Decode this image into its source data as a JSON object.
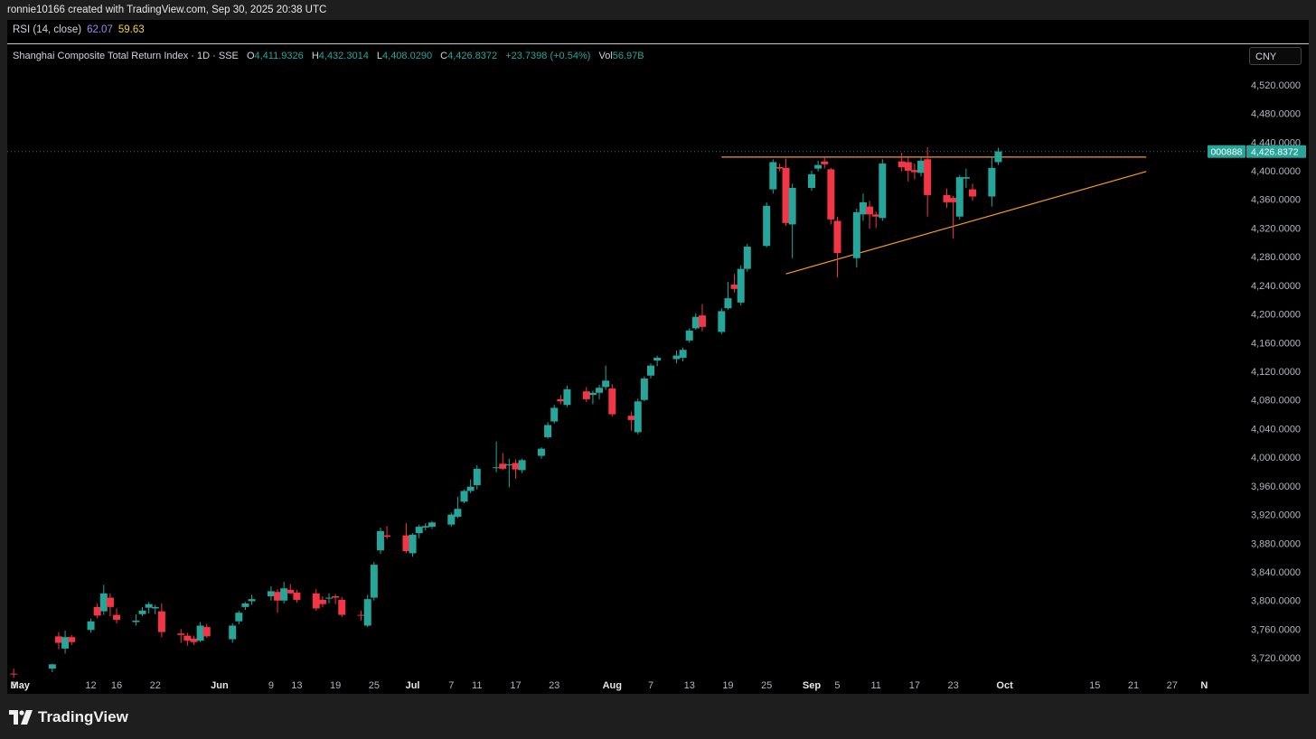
{
  "header": {
    "author_line": "ronnie10166 created with TradingView.com, Sep 30, 2025 20:38 UTC"
  },
  "rsi": {
    "label": "RSI (14, close)",
    "value1": "62.07",
    "value2": "59.63"
  },
  "legend": {
    "symbol": "Shanghai Composite Total Return Index · 1D · SSE",
    "o_label": "O",
    "o_value": "4,411.9326",
    "h_label": "H",
    "h_value": "4,432.3014",
    "l_label": "L",
    "l_value": "4,408.0290",
    "c_label": "C",
    "c_value": "4,426.8372",
    "change": "+23.7398 (+0.54%)",
    "vol_label": "Vol",
    "vol_value": "56.97B"
  },
  "currency": "CNY",
  "price_label": {
    "ticker": "000888",
    "price": "4,426.8372",
    "value": 4426.8372
  },
  "colors": {
    "up": "#26a69a",
    "down": "#f23645",
    "trendline": "#f59a23",
    "background": "#000000"
  },
  "brand": "TradingView",
  "chart_data": {
    "type": "candlestick",
    "y_axis": {
      "ticks": [
        3720,
        3760,
        3800,
        3840,
        3880,
        3920,
        3960,
        4000,
        4040,
        4080,
        4120,
        4160,
        4200,
        4240,
        4280,
        4320,
        4360,
        4400,
        4440,
        4480,
        4520
      ],
      "tick_labels": [
        "3,720.0000",
        "3,760.0000",
        "3,800.0000",
        "3,840.0000",
        "3,880.0000",
        "3,920.0000",
        "3,960.0000",
        "4,000.0000",
        "4,040.0000",
        "4,080.0000",
        "4,120.0000",
        "4,160.0000",
        "4,200.0000",
        "4,240.0000",
        "4,280.0000",
        "4,320.0000",
        "4,360.0000",
        "4,400.0000",
        "4,440.0000",
        "4,480.0000",
        "4,520.0000"
      ],
      "range": [
        3695,
        4545
      ]
    },
    "x_axis": {
      "ticks": [
        {
          "date": "2025-04-30",
          "label": "3",
          "bold": false
        },
        {
          "date": "2025-05-01",
          "label": "May",
          "bold": true
        },
        {
          "date": "2025-05-12",
          "label": "12",
          "bold": false
        },
        {
          "date": "2025-05-16",
          "label": "16",
          "bold": false
        },
        {
          "date": "2025-05-22",
          "label": "22",
          "bold": false
        },
        {
          "date": "2025-06-01",
          "label": "Jun",
          "bold": true
        },
        {
          "date": "2025-06-09",
          "label": "9",
          "bold": false
        },
        {
          "date": "2025-06-13",
          "label": "13",
          "bold": false
        },
        {
          "date": "2025-06-19",
          "label": "19",
          "bold": false
        },
        {
          "date": "2025-06-25",
          "label": "25",
          "bold": false
        },
        {
          "date": "2025-07-01",
          "label": "Jul",
          "bold": true
        },
        {
          "date": "2025-07-07",
          "label": "7",
          "bold": false
        },
        {
          "date": "2025-07-11",
          "label": "11",
          "bold": false
        },
        {
          "date": "2025-07-17",
          "label": "17",
          "bold": false
        },
        {
          "date": "2025-07-23",
          "label": "23",
          "bold": false
        },
        {
          "date": "2025-08-01",
          "label": "Aug",
          "bold": true
        },
        {
          "date": "2025-08-07",
          "label": "7",
          "bold": false
        },
        {
          "date": "2025-08-13",
          "label": "13",
          "bold": false
        },
        {
          "date": "2025-08-19",
          "label": "19",
          "bold": false
        },
        {
          "date": "2025-08-25",
          "label": "25",
          "bold": false
        },
        {
          "date": "2025-09-01",
          "label": "Sep",
          "bold": true
        },
        {
          "date": "2025-09-05",
          "label": "5",
          "bold": false
        },
        {
          "date": "2025-09-11",
          "label": "11",
          "bold": false
        },
        {
          "date": "2025-09-17",
          "label": "17",
          "bold": false
        },
        {
          "date": "2025-09-23",
          "label": "23",
          "bold": false
        },
        {
          "date": "2025-10-01",
          "label": "Oct",
          "bold": true
        },
        {
          "date": "2025-10-15",
          "label": "15",
          "bold": false
        },
        {
          "date": "2025-10-21",
          "label": "21",
          "bold": false
        },
        {
          "date": "2025-10-27",
          "label": "27",
          "bold": false
        },
        {
          "date": "2025-11-01",
          "label": "N",
          "bold": true
        }
      ]
    },
    "candles": [
      {
        "d": "2025-04-30",
        "o": 3698,
        "h": 3705,
        "l": 3692,
        "c": 3697
      },
      {
        "d": "2025-05-06",
        "o": 3705,
        "h": 3712,
        "l": 3700,
        "c": 3711
      },
      {
        "d": "2025-05-07",
        "o": 3750,
        "h": 3756,
        "l": 3732,
        "c": 3741
      },
      {
        "d": "2025-05-08",
        "o": 3733,
        "h": 3758,
        "l": 3726,
        "c": 3749
      },
      {
        "d": "2025-05-09",
        "o": 3749,
        "h": 3752,
        "l": 3738,
        "c": 3742
      },
      {
        "d": "2025-05-12",
        "o": 3759,
        "h": 3775,
        "l": 3755,
        "c": 3771
      },
      {
        "d": "2025-05-13",
        "o": 3791,
        "h": 3796,
        "l": 3775,
        "c": 3779
      },
      {
        "d": "2025-05-14",
        "o": 3785,
        "h": 3822,
        "l": 3780,
        "c": 3810
      },
      {
        "d": "2025-05-15",
        "o": 3804,
        "h": 3810,
        "l": 3778,
        "c": 3791
      },
      {
        "d": "2025-05-16",
        "o": 3780,
        "h": 3789,
        "l": 3768,
        "c": 3773
      },
      {
        "d": "2025-05-19",
        "o": 3770,
        "h": 3781,
        "l": 3765,
        "c": 3772
      },
      {
        "d": "2025-05-20",
        "o": 3781,
        "h": 3791,
        "l": 3778,
        "c": 3786
      },
      {
        "d": "2025-05-21",
        "o": 3790,
        "h": 3798,
        "l": 3782,
        "c": 3795
      },
      {
        "d": "2025-05-22",
        "o": 3789,
        "h": 3794,
        "l": 3781,
        "c": 3791
      },
      {
        "d": "2025-05-23",
        "o": 3785,
        "h": 3796,
        "l": 3749,
        "c": 3756
      },
      {
        "d": "2025-05-26",
        "o": 3754,
        "h": 3760,
        "l": 3741,
        "c": 3752
      },
      {
        "d": "2025-05-27",
        "o": 3751,
        "h": 3755,
        "l": 3737,
        "c": 3744
      },
      {
        "d": "2025-05-28",
        "o": 3747,
        "h": 3751,
        "l": 3738,
        "c": 3742
      },
      {
        "d": "2025-05-29",
        "o": 3744,
        "h": 3770,
        "l": 3742,
        "c": 3765
      },
      {
        "d": "2025-05-30",
        "o": 3763,
        "h": 3767,
        "l": 3748,
        "c": 3750
      },
      {
        "d": "2025-06-03",
        "o": 3746,
        "h": 3768,
        "l": 3741,
        "c": 3765
      },
      {
        "d": "2025-06-04",
        "o": 3771,
        "h": 3786,
        "l": 3767,
        "c": 3783
      },
      {
        "d": "2025-06-05",
        "o": 3791,
        "h": 3798,
        "l": 3787,
        "c": 3796
      },
      {
        "d": "2025-06-06",
        "o": 3799,
        "h": 3808,
        "l": 3794,
        "c": 3802
      },
      {
        "d": "2025-06-09",
        "o": 3806,
        "h": 3820,
        "l": 3800,
        "c": 3813
      },
      {
        "d": "2025-06-10",
        "o": 3812,
        "h": 3816,
        "l": 3783,
        "c": 3800
      },
      {
        "d": "2025-06-11",
        "o": 3800,
        "h": 3826,
        "l": 3796,
        "c": 3817
      },
      {
        "d": "2025-06-12",
        "o": 3815,
        "h": 3823,
        "l": 3809,
        "c": 3810
      },
      {
        "d": "2025-06-13",
        "o": 3811,
        "h": 3815,
        "l": 3797,
        "c": 3801
      },
      {
        "d": "2025-06-16",
        "o": 3810,
        "h": 3816,
        "l": 3786,
        "c": 3789
      },
      {
        "d": "2025-06-17",
        "o": 3801,
        "h": 3806,
        "l": 3791,
        "c": 3795
      },
      {
        "d": "2025-06-18",
        "o": 3803,
        "h": 3810,
        "l": 3796,
        "c": 3804
      },
      {
        "d": "2025-06-19",
        "o": 3806,
        "h": 3809,
        "l": 3795,
        "c": 3804
      },
      {
        "d": "2025-06-20",
        "o": 3801,
        "h": 3805,
        "l": 3777,
        "c": 3780
      },
      {
        "d": "2025-06-23",
        "o": 3780,
        "h": 3786,
        "l": 3772,
        "c": 3779
      },
      {
        "d": "2025-06-24",
        "o": 3765,
        "h": 3808,
        "l": 3763,
        "c": 3802
      },
      {
        "d": "2025-06-25",
        "o": 3804,
        "h": 3854,
        "l": 3800,
        "c": 3850
      },
      {
        "d": "2025-06-26",
        "o": 3870,
        "h": 3902,
        "l": 3865,
        "c": 3897
      },
      {
        "d": "2025-06-27",
        "o": 3891,
        "h": 3904,
        "l": 3886,
        "c": 3889
      },
      {
        "d": "2025-06-30",
        "o": 3891,
        "h": 3908,
        "l": 3866,
        "c": 3869
      },
      {
        "d": "2025-07-01",
        "o": 3866,
        "h": 3894,
        "l": 3861,
        "c": 3892
      },
      {
        "d": "2025-07-02",
        "o": 3894,
        "h": 3906,
        "l": 3887,
        "c": 3903
      },
      {
        "d": "2025-07-03",
        "o": 3902,
        "h": 3908,
        "l": 3898,
        "c": 3904
      },
      {
        "d": "2025-07-04",
        "o": 3903,
        "h": 3911,
        "l": 3900,
        "c": 3909
      },
      {
        "d": "2025-07-07",
        "o": 3906,
        "h": 3923,
        "l": 3903,
        "c": 3920
      },
      {
        "d": "2025-07-08",
        "o": 3917,
        "h": 3945,
        "l": 3915,
        "c": 3928
      },
      {
        "d": "2025-07-09",
        "o": 3938,
        "h": 3955,
        "l": 3936,
        "c": 3953
      },
      {
        "d": "2025-07-10",
        "o": 3953,
        "h": 3969,
        "l": 3950,
        "c": 3959
      },
      {
        "d": "2025-07-11",
        "o": 3961,
        "h": 3989,
        "l": 3955,
        "c": 3984
      },
      {
        "d": "2025-07-14",
        "o": 3985,
        "h": 4022,
        "l": 3979,
        "c": 3986
      },
      {
        "d": "2025-07-15",
        "o": 3991,
        "h": 4006,
        "l": 3982,
        "c": 3984
      },
      {
        "d": "2025-07-16",
        "o": 3990,
        "h": 3998,
        "l": 3958,
        "c": 3990
      },
      {
        "d": "2025-07-17",
        "o": 3992,
        "h": 3997,
        "l": 3970,
        "c": 3983
      },
      {
        "d": "2025-07-18",
        "o": 3982,
        "h": 3998,
        "l": 3978,
        "c": 3996
      },
      {
        "d": "2025-07-21",
        "o": 4002,
        "h": 4014,
        "l": 3998,
        "c": 4012
      },
      {
        "d": "2025-07-22",
        "o": 4028,
        "h": 4049,
        "l": 4026,
        "c": 4045
      },
      {
        "d": "2025-07-23",
        "o": 4050,
        "h": 4073,
        "l": 4047,
        "c": 4069
      },
      {
        "d": "2025-07-24",
        "o": 4081,
        "h": 4087,
        "l": 4074,
        "c": 4078
      },
      {
        "d": "2025-07-25",
        "o": 4073,
        "h": 4100,
        "l": 4070,
        "c": 4095
      },
      {
        "d": "2025-07-28",
        "o": 4092,
        "h": 4098,
        "l": 4077,
        "c": 4081
      },
      {
        "d": "2025-07-29",
        "o": 4087,
        "h": 4093,
        "l": 4074,
        "c": 4090
      },
      {
        "d": "2025-07-30",
        "o": 4090,
        "h": 4101,
        "l": 4081,
        "c": 4097
      },
      {
        "d": "2025-07-31",
        "o": 4098,
        "h": 4128,
        "l": 4094,
        "c": 4107
      },
      {
        "d": "2025-08-01",
        "o": 4096,
        "h": 4102,
        "l": 4057,
        "c": 4060
      },
      {
        "d": "2025-08-04",
        "o": 4058,
        "h": 4064,
        "l": 4037,
        "c": 4052
      },
      {
        "d": "2025-08-05",
        "o": 4035,
        "h": 4082,
        "l": 4032,
        "c": 4078
      },
      {
        "d": "2025-08-06",
        "o": 4080,
        "h": 4113,
        "l": 4078,
        "c": 4110
      },
      {
        "d": "2025-08-07",
        "o": 4114,
        "h": 4131,
        "l": 4110,
        "c": 4128
      },
      {
        "d": "2025-08-08",
        "o": 4135,
        "h": 4142,
        "l": 4127,
        "c": 4139
      },
      {
        "d": "2025-08-11",
        "o": 4137,
        "h": 4149,
        "l": 4131,
        "c": 4142
      },
      {
        "d": "2025-08-12",
        "o": 4139,
        "h": 4153,
        "l": 4134,
        "c": 4150
      },
      {
        "d": "2025-08-13",
        "o": 4163,
        "h": 4180,
        "l": 4160,
        "c": 4177
      },
      {
        "d": "2025-08-14",
        "o": 4180,
        "h": 4201,
        "l": 4178,
        "c": 4196
      },
      {
        "d": "2025-08-15",
        "o": 4198,
        "h": 4214,
        "l": 4176,
        "c": 4182
      },
      {
        "d": "2025-08-18",
        "o": 4175,
        "h": 4208,
        "l": 4172,
        "c": 4204
      },
      {
        "d": "2025-08-19",
        "o": 4208,
        "h": 4245,
        "l": 4206,
        "c": 4222
      },
      {
        "d": "2025-08-20",
        "o": 4241,
        "h": 4256,
        "l": 4230,
        "c": 4235
      },
      {
        "d": "2025-08-21",
        "o": 4216,
        "h": 4268,
        "l": 4212,
        "c": 4263
      },
      {
        "d": "2025-08-22",
        "o": 4263,
        "h": 4298,
        "l": 4259,
        "c": 4294
      },
      {
        "d": "2025-08-25",
        "o": 4295,
        "h": 4356,
        "l": 4293,
        "c": 4351
      },
      {
        "d": "2025-08-26",
        "o": 4374,
        "h": 4416,
        "l": 4368,
        "c": 4412
      },
      {
        "d": "2025-08-27",
        "o": 4405,
        "h": 4410,
        "l": 4399,
        "c": 4403
      },
      {
        "d": "2025-08-28",
        "o": 4404,
        "h": 4417,
        "l": 4323,
        "c": 4327
      },
      {
        "d": "2025-08-29",
        "o": 4325,
        "h": 4382,
        "l": 4278,
        "c": 4376
      },
      {
        "d": "2025-09-01",
        "o": 4376,
        "h": 4400,
        "l": 4372,
        "c": 4395
      },
      {
        "d": "2025-09-02",
        "o": 4403,
        "h": 4414,
        "l": 4399,
        "c": 4408
      },
      {
        "d": "2025-09-03",
        "o": 4413,
        "h": 4419,
        "l": 4403,
        "c": 4409
      },
      {
        "d": "2025-09-04",
        "o": 4402,
        "h": 4404,
        "l": 4325,
        "c": 4332
      },
      {
        "d": "2025-09-05",
        "o": 4330,
        "h": 4336,
        "l": 4251,
        "c": 4285
      },
      {
        "d": "2025-09-08",
        "o": 4278,
        "h": 4347,
        "l": 4265,
        "c": 4342
      },
      {
        "d": "2025-09-09",
        "o": 4339,
        "h": 4368,
        "l": 4330,
        "c": 4356
      },
      {
        "d": "2025-09-10",
        "o": 4350,
        "h": 4358,
        "l": 4319,
        "c": 4339
      },
      {
        "d": "2025-09-11",
        "o": 4339,
        "h": 4343,
        "l": 4320,
        "c": 4336
      },
      {
        "d": "2025-09-12",
        "o": 4334,
        "h": 4416,
        "l": 4330,
        "c": 4410
      },
      {
        "d": "2025-09-15",
        "o": 4413,
        "h": 4425,
        "l": 4399,
        "c": 4405
      },
      {
        "d": "2025-09-16",
        "o": 4412,
        "h": 4418,
        "l": 4385,
        "c": 4400
      },
      {
        "d": "2025-09-17",
        "o": 4401,
        "h": 4410,
        "l": 4388,
        "c": 4398
      },
      {
        "d": "2025-09-18",
        "o": 4397,
        "h": 4418,
        "l": 4392,
        "c": 4414
      },
      {
        "d": "2025-09-19",
        "o": 4416,
        "h": 4433,
        "l": 4336,
        "c": 4366
      },
      {
        "d": "2025-09-22",
        "o": 4366,
        "h": 4375,
        "l": 4348,
        "c": 4356
      },
      {
        "d": "2025-09-23",
        "o": 4362,
        "h": 4365,
        "l": 4305,
        "c": 4356
      },
      {
        "d": "2025-09-24",
        "o": 4336,
        "h": 4394,
        "l": 4332,
        "c": 4391
      },
      {
        "d": "2025-09-25",
        "o": 4389,
        "h": 4403,
        "l": 4376,
        "c": 4391
      },
      {
        "d": "2025-09-26",
        "o": 4374,
        "h": 4382,
        "l": 4358,
        "c": 4364
      },
      {
        "d": "2025-09-29",
        "o": 4364,
        "h": 4420,
        "l": 4350,
        "c": 4404
      },
      {
        "d": "2025-09-30",
        "o": 4412,
        "h": 4432,
        "l": 4408,
        "c": 4427
      }
    ],
    "trendlines": [
      {
        "name": "resistance",
        "from": {
          "d": "2025-08-18",
          "v": 4419
        },
        "to": {
          "d": "2025-10-23",
          "v": 4419
        }
      },
      {
        "name": "support",
        "from": {
          "d": "2025-08-28",
          "v": 4256
        },
        "to": {
          "d": "2025-10-23",
          "v": 4399
        }
      }
    ],
    "last_price_line": 4426.8372
  }
}
